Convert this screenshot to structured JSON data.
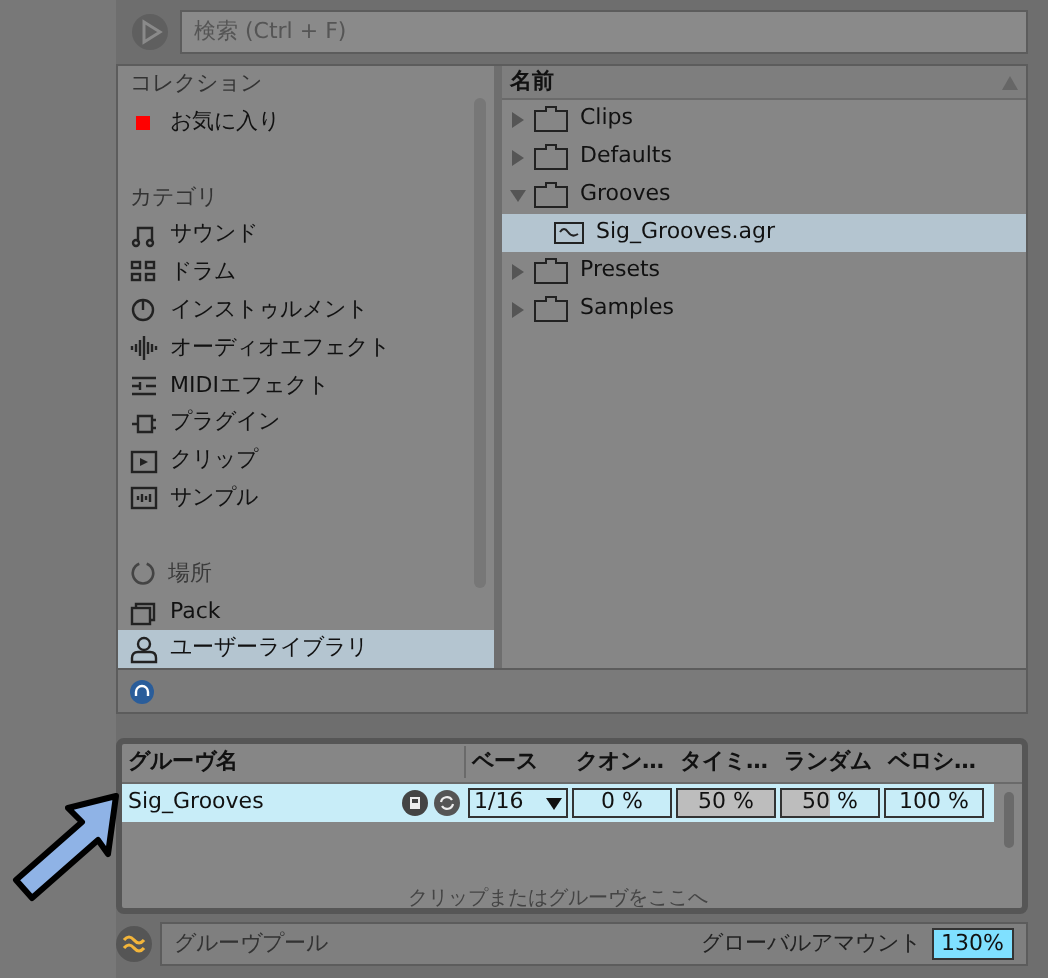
{
  "search": {
    "placeholder": "検索 (Ctrl + F)"
  },
  "sidebar": {
    "sections": [
      {
        "title": "コレクション",
        "items": [
          {
            "label": "お気に入り",
            "color": "#ff0000",
            "selected": false
          }
        ]
      },
      {
        "title": "カテゴリ",
        "items": [
          {
            "label": "サウンド",
            "selected": false
          },
          {
            "label": "ドラム",
            "selected": false
          },
          {
            "label": "インストゥルメント",
            "selected": false
          },
          {
            "label": "オーディオエフェクト",
            "selected": false
          },
          {
            "label": "MIDIエフェクト",
            "selected": false
          },
          {
            "label": "プラグイン",
            "selected": false
          },
          {
            "label": "クリップ",
            "selected": false
          },
          {
            "label": "サンプル",
            "selected": false
          }
        ]
      },
      {
        "title": "場所",
        "items": [
          {
            "label": "Pack",
            "selected": false
          },
          {
            "label": "ユーザーライブラリ",
            "selected": true
          }
        ]
      }
    ]
  },
  "files": {
    "column": "名前",
    "items": [
      {
        "label": "Clips",
        "kind": "folder",
        "expanded": false,
        "selected": false
      },
      {
        "label": "Defaults",
        "kind": "folder",
        "expanded": false,
        "selected": false
      },
      {
        "label": "Grooves",
        "kind": "folder",
        "expanded": true,
        "selected": false,
        "children": [
          {
            "label": "Sig_Grooves.agr",
            "kind": "groove",
            "selected": true
          }
        ]
      },
      {
        "label": "Presets",
        "kind": "folder",
        "expanded": false,
        "selected": false
      },
      {
        "label": "Samples",
        "kind": "folder",
        "expanded": false,
        "selected": false
      }
    ]
  },
  "groove_pool": {
    "columns": [
      "グルーヴ名",
      "ベース",
      "クオン…",
      "タイミ…",
      "ランダム",
      "ベロシ…"
    ],
    "rows": [
      {
        "name": "Sig_Grooves",
        "selected": true,
        "base": "1/16",
        "quantize": {
          "value": "0 %",
          "level": 0
        },
        "timing": {
          "value": "50 %",
          "level": 1
        },
        "random": {
          "value": "50 %",
          "level": 0.5
        },
        "velocity": {
          "value": "100 %",
          "level": 0
        }
      }
    ],
    "drop_hint": "クリップまたはグルーヴをここへ",
    "title": "グルーヴプール",
    "global_amount_label": "グローバルアマウント",
    "global_amount": "130%"
  }
}
